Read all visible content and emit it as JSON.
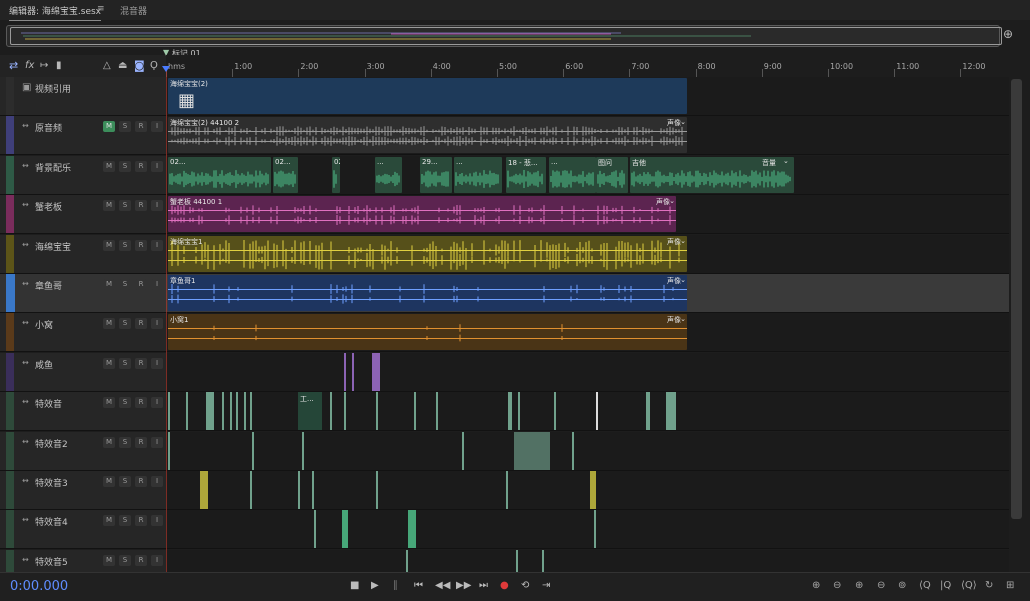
{
  "tabs": [
    {
      "label": "编辑器: 海绵宝宝.sesx",
      "active": true
    },
    {
      "label": "混音器",
      "active": false
    }
  ],
  "tab_menu_icon": "hamburger-icon",
  "marker_label": "标记 01",
  "ruler": {
    "labels": [
      "hms",
      "1:00",
      "2:00",
      "3:00",
      "4:00",
      "5:00",
      "6:00",
      "7:00",
      "8:00",
      "9:00",
      "10:00",
      "11:00",
      "12:00"
    ]
  },
  "toolbar_icons": [
    "swap-icon",
    "fx-icon",
    "send-icon",
    "meter-icon",
    "metronome-icon",
    "input-icon",
    "headphones-icon",
    "mic-icon"
  ],
  "tracks": [
    {
      "name": "视频引用",
      "type": "video",
      "color": "#2c2c2c",
      "clips": [
        {
          "label": "海绵宝宝(2)",
          "color": "#1e3a5a"
        }
      ]
    },
    {
      "name": "原音频",
      "color": "#3f3f7a",
      "m_on": true,
      "clips": [
        {
          "label": "海绵宝宝(2) 44100 2",
          "right": "声像",
          "color": "#2e2e2e"
        }
      ]
    },
    {
      "name": "背景配乐",
      "color": "#2e5a46",
      "clips": [
        {
          "label": "02..."
        },
        {
          "label": "02..."
        },
        {
          "label": "02..."
        },
        {
          "label": "..."
        },
        {
          "label": "29..."
        },
        {
          "label": "..."
        },
        {
          "label": "18 - 悲..."
        },
        {
          "label": "..."
        },
        {
          "label": "图问"
        },
        {
          "label": "吉他"
        },
        {
          "label": "",
          "right": "音量"
        }
      ]
    },
    {
      "name": "蟹老板",
      "color": "#7a2c5c",
      "clips": [
        {
          "label": "蟹老板 44100 1",
          "right": "声像",
          "color": "#5c2450"
        }
      ]
    },
    {
      "name": "海绵宝宝",
      "color": "#5c5418",
      "clips": [
        {
          "label": "海绵宝宝1",
          "right": "声像",
          "color": "#56501a"
        }
      ]
    },
    {
      "name": "章鱼哥",
      "color": "#3a78c8",
      "selected": true,
      "clips": [
        {
          "label": "章鱼哥1",
          "right": "声像",
          "color": "#1e3560"
        }
      ]
    },
    {
      "name": "小窝",
      "color": "#5a3a1a",
      "clips": [
        {
          "label": "小窝1",
          "right": "声像",
          "color": "#4a3416"
        }
      ]
    },
    {
      "name": "咸鱼",
      "color": "#3a2e5a",
      "clips": []
    },
    {
      "name": "特效音",
      "color": "#2e4a3a",
      "clips": [
        {
          "label": "工..."
        }
      ]
    },
    {
      "name": "特效音2",
      "color": "#2e4a3a",
      "clips": []
    },
    {
      "name": "特效音3",
      "color": "#2e4a3a",
      "clips": []
    },
    {
      "name": "特效音4",
      "color": "#2e4a3a",
      "clips": []
    },
    {
      "name": "特效音5",
      "color": "#2e4a3a",
      "clips": []
    }
  ],
  "track_buttons": {
    "mute": "M",
    "solo": "S",
    "record": "R",
    "input": "I"
  },
  "timecode": "0:00.000",
  "transport_icons": [
    "stop-icon",
    "play-icon",
    "pause-icon",
    "go-to-start-icon",
    "rewind-icon",
    "fast-forward-icon",
    "go-to-end-icon",
    "record-icon",
    "loop-icon",
    "skip-icon"
  ],
  "zoom_icons": [
    "zoom-in-amplitude-icon",
    "zoom-out-amplitude-icon",
    "zoom-in-time-icon",
    "zoom-out-time-icon",
    "zoom-selection-icon",
    "zoom-full-icon",
    "zoom-in-left-icon",
    "zoom-in-right-icon",
    "zoom-out-full-icon",
    "zoom-reset-icon",
    "zoom-tracks-icon"
  ]
}
